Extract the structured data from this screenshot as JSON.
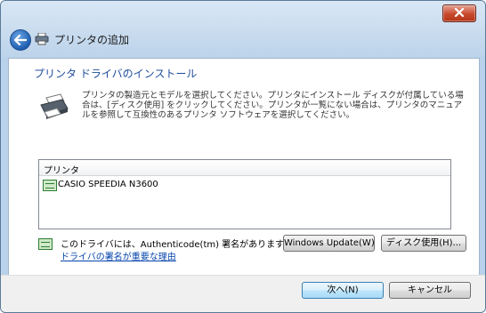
{
  "window": {
    "title": "プリンタの追加"
  },
  "content": {
    "heading": "プリンタ ドライバのインストール",
    "description": "プリンタの製造元とモデルを選択してください。プリンタにインストール ディスクが付属している場合は、[ディスク使用] をクリックしてください。プリンタが一覧にない場合は、プリンタのマニュアルを参照して互換性のあるプリンタ ソフトウェアを選択してください。"
  },
  "printer_list": {
    "header": "プリンタ",
    "items": [
      "CASIO SPEEDIA N3600"
    ]
  },
  "signature": {
    "text": "このドライバには、Authenticode(tm) 署名があります。",
    "link": "ドライバの署名が重要な理由"
  },
  "buttons": {
    "windows_update": "Windows Update(W)",
    "have_disk": "ディスク使用(H)...",
    "next": "次へ(N)",
    "cancel": "キャンセル"
  },
  "colors": {
    "heading": "#1f4c9c",
    "link": "#0645ad",
    "close_button": "#c84a2d"
  },
  "icons": {
    "back": "back-arrow-icon",
    "printer": "printer-icon",
    "close": "close-icon",
    "driver": "driver-icon"
  }
}
